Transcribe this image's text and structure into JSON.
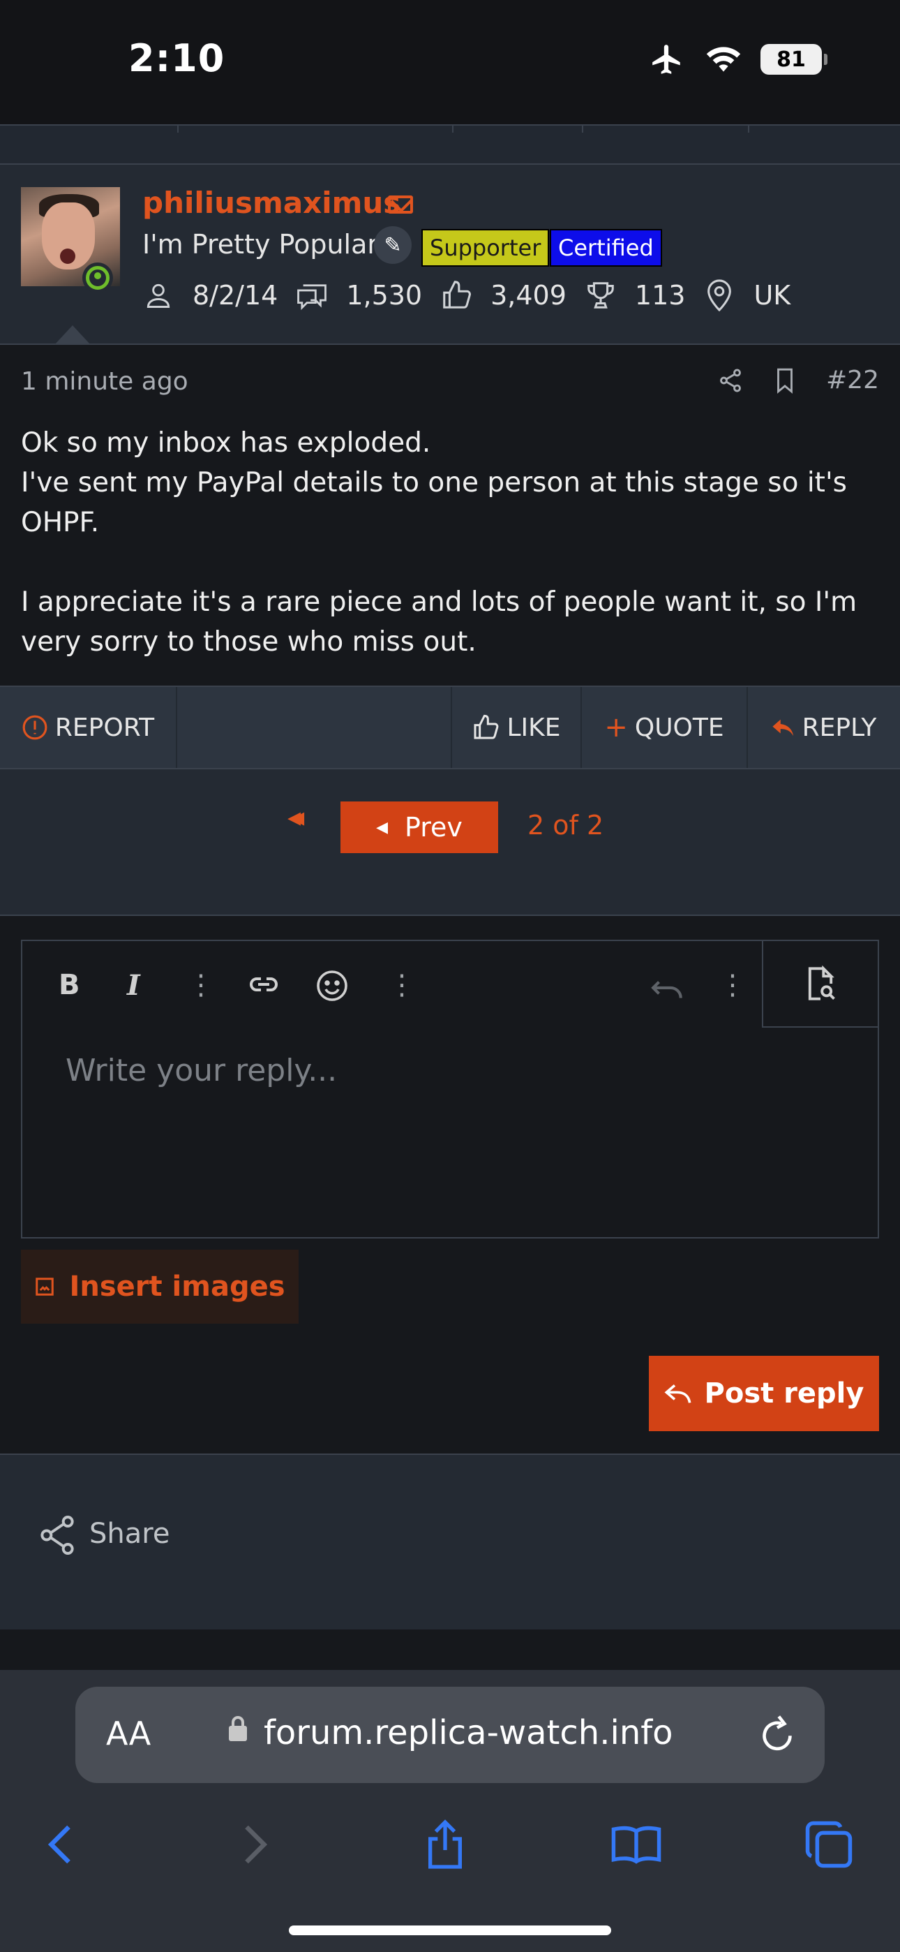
{
  "status_bar": {
    "time": "2:10",
    "battery": "81"
  },
  "user": {
    "name": "philiusmaximus",
    "title": "I'm Pretty Popular",
    "badges": [
      "Supporter",
      "Certified"
    ],
    "stats": {
      "joined": "8/2/14",
      "messages": "1,530",
      "reactions": "3,409",
      "points": "113",
      "location": "UK"
    }
  },
  "post": {
    "time": "1 minute ago",
    "number": "#22",
    "lines": [
      "Ok so my inbox has exploded.",
      "I've sent my PayPal details to one person at this stage so it's OHPF.",
      "",
      "I appreciate it's a rare piece and lots of people want it, so I'm very sorry to those who miss out."
    ]
  },
  "actions": {
    "report": "REPORT",
    "like": "LIKE",
    "quote": "QUOTE",
    "reply": "REPLY"
  },
  "pagination": {
    "prev": "Prev",
    "page_count": "2 of 2"
  },
  "editor": {
    "placeholder": "Write your reply...",
    "insert_images": "Insert images",
    "post_reply": "Post reply"
  },
  "share": {
    "label": "Share"
  },
  "browser": {
    "aa": "AA",
    "url": "forum.replica-watch.info"
  },
  "colors": {
    "accent": "#e0541f",
    "button": "#d24215",
    "supporter": "#c5c81a",
    "certified": "#0d0dea",
    "online": "#6fbe2b",
    "ios_blue": "#3478f6"
  }
}
